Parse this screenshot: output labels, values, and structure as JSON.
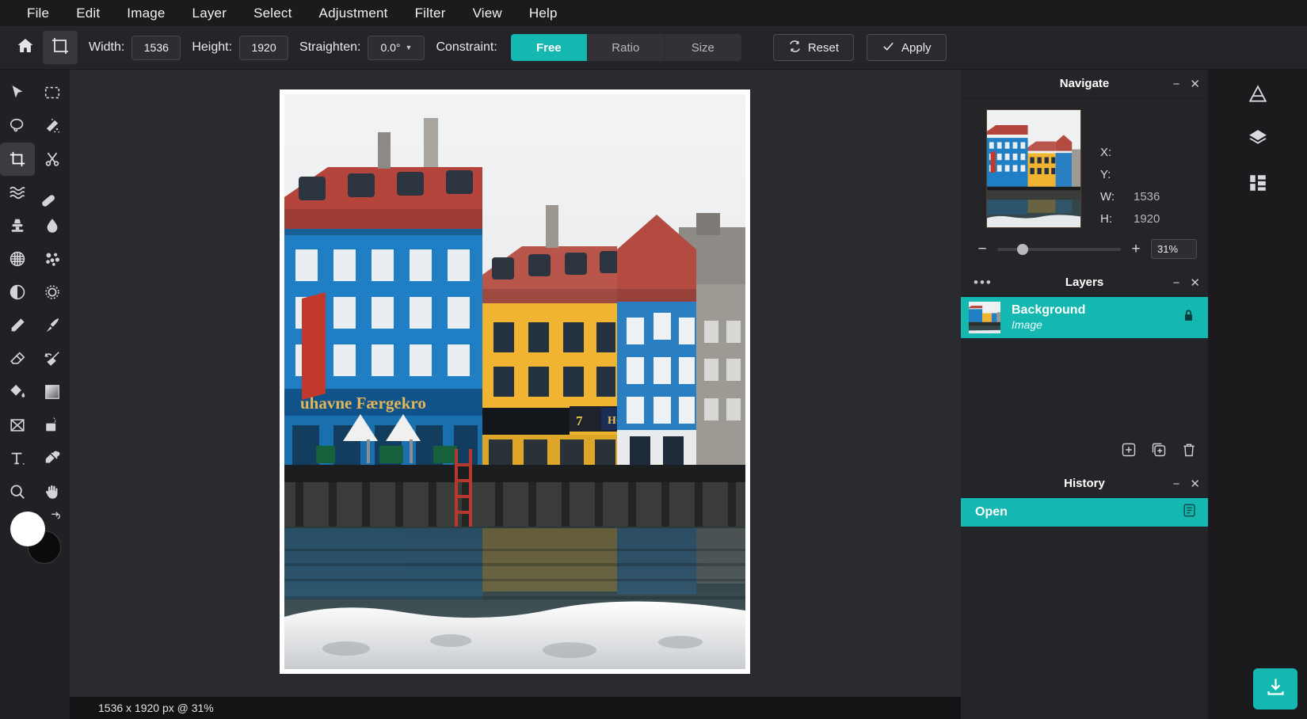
{
  "menu": {
    "items": [
      {
        "label": "File"
      },
      {
        "label": "Edit"
      },
      {
        "label": "Image"
      },
      {
        "label": "Layer"
      },
      {
        "label": "Select"
      },
      {
        "label": "Adjustment"
      },
      {
        "label": "Filter"
      },
      {
        "label": "View"
      },
      {
        "label": "Help"
      }
    ]
  },
  "options": {
    "home_icon": "home-icon",
    "tool_icon": "crop-tool-icon",
    "width_label": "Width:",
    "width_value": "1536",
    "height_label": "Height:",
    "height_value": "1920",
    "straighten_label": "Straighten:",
    "straighten_value": "0.0°",
    "constraint_label": "Constraint:",
    "constraint_options": [
      {
        "label": "Free",
        "selected": true
      },
      {
        "label": "Ratio",
        "selected": false
      },
      {
        "label": "Size",
        "selected": false
      }
    ],
    "reset_label": "Reset",
    "apply_label": "Apply"
  },
  "tools": [
    {
      "name": "move-tool",
      "icon": "cursor-arrow-icon"
    },
    {
      "name": "rectangular-marquee-tool",
      "icon": "dashed-rectangle-icon"
    },
    {
      "name": "lasso-tool",
      "icon": "lasso-icon"
    },
    {
      "name": "magic-wand-tool",
      "icon": "magic-wand-icon"
    },
    {
      "name": "crop-tool",
      "icon": "crop-icon",
      "selected": true
    },
    {
      "name": "cut-tool",
      "icon": "scissors-icon"
    },
    {
      "name": "liquify-tool",
      "icon": "waves-icon"
    },
    {
      "name": "healing-brush-tool",
      "icon": "bandage-icon"
    },
    {
      "name": "clone-stamp-tool",
      "icon": "stamp-icon"
    },
    {
      "name": "blur-tool",
      "icon": "droplet-icon"
    },
    {
      "name": "halftone-tool",
      "icon": "dot-grid-circle-icon"
    },
    {
      "name": "bokeh-tool",
      "icon": "bubbles-icon"
    },
    {
      "name": "dodge-burn-tool",
      "icon": "half-circle-icon"
    },
    {
      "name": "sharpen-tool",
      "icon": "gear-sun-icon"
    },
    {
      "name": "pencil-tool",
      "icon": "pencil-icon"
    },
    {
      "name": "paintbrush-tool",
      "icon": "paintbrush-icon"
    },
    {
      "name": "eraser-tool",
      "icon": "eraser-icon"
    },
    {
      "name": "smudge-tool",
      "icon": "smudge-brush-icon"
    },
    {
      "name": "paint-bucket-tool",
      "icon": "paint-bucket-icon"
    },
    {
      "name": "gradient-tool",
      "icon": "gradient-square-icon"
    },
    {
      "name": "transform-tool",
      "icon": "crossed-box-icon"
    },
    {
      "name": "shape-tool",
      "icon": "rounded-shape-icon"
    },
    {
      "name": "text-tool",
      "icon": "text-t-icon"
    },
    {
      "name": "eyedropper-tool",
      "icon": "eyedropper-icon"
    },
    {
      "name": "zoom-tool",
      "icon": "magnifier-icon"
    },
    {
      "name": "hand-tool",
      "icon": "hand-icon"
    }
  ],
  "colors": {
    "accent": "#14b8b1",
    "foreground_swatch": "#ffffff",
    "background_swatch": "#0b0b0c",
    "panel_bg": "#252529",
    "canvas_bg": "#2b2b2f"
  },
  "canvas": {
    "status_text": "1536 x 1920 px @ 31%"
  },
  "navigate": {
    "title": "Navigate",
    "minimize_icon": "minimize-icon",
    "close_icon": "close-icon",
    "coords": [
      {
        "label": "X:",
        "value": ""
      },
      {
        "label": "Y:",
        "value": ""
      },
      {
        "label": "W:",
        "value": "1536"
      },
      {
        "label": "H:",
        "value": "1920"
      }
    ],
    "zoom_minus": "−",
    "zoom_plus": "+",
    "zoom_value": "31%"
  },
  "layers": {
    "title": "Layers",
    "menu_icon": "more-dots-icon",
    "minimize_icon": "minimize-icon",
    "close_icon": "close-icon",
    "items": [
      {
        "name": "Background",
        "kind": "Image",
        "locked": true,
        "selected": true
      }
    ],
    "actions": [
      {
        "name": "add-layer-button",
        "icon": "plus-square-icon"
      },
      {
        "name": "duplicate-layer-button",
        "icon": "copy-square-icon"
      },
      {
        "name": "delete-layer-button",
        "icon": "trash-icon"
      }
    ]
  },
  "history": {
    "title": "History",
    "minimize_icon": "minimize-icon",
    "close_icon": "close-icon",
    "items": [
      {
        "label": "Open",
        "icon": "document-icon",
        "selected": true
      }
    ]
  },
  "rail": {
    "buttons": [
      {
        "name": "adjustments-rail-button",
        "icon": "triangle-adjust-icon"
      },
      {
        "name": "layers-rail-button",
        "icon": "layers-stack-icon"
      },
      {
        "name": "channels-rail-button",
        "icon": "channels-icon"
      }
    ],
    "export": {
      "name": "export-button",
      "icon": "download-tray-icon"
    }
  }
}
